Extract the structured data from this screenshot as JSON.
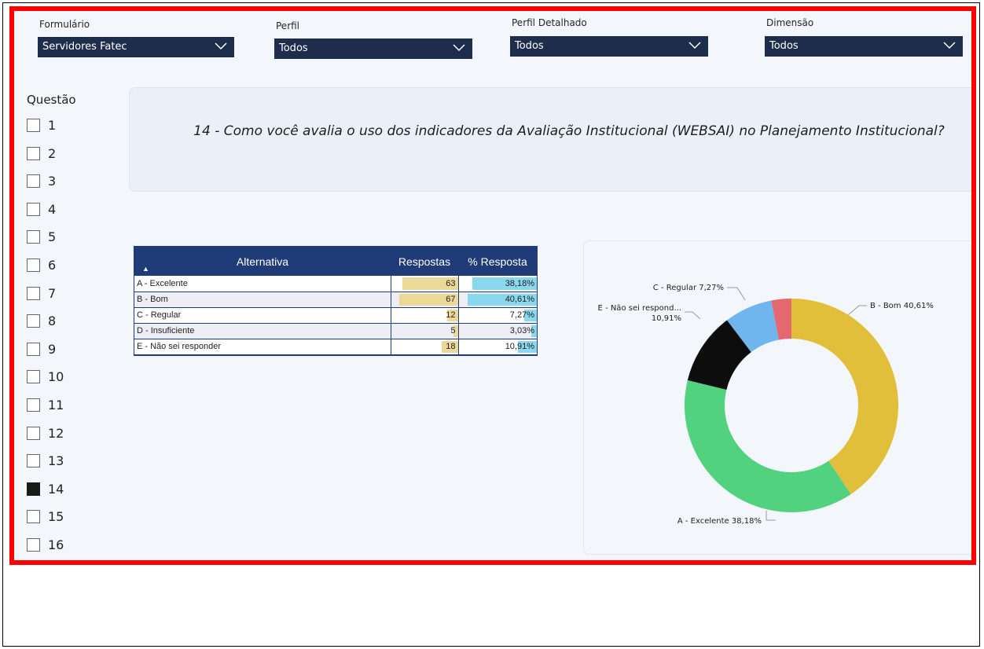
{
  "filters": [
    {
      "label": "Formulário",
      "value": "Servidores Fatec"
    },
    {
      "label": "Perfil",
      "value": "Todos"
    },
    {
      "label": "Perfil Detalhado",
      "value": "Todos"
    },
    {
      "label": "Dimensão",
      "value": "Todos"
    }
  ],
  "questions": {
    "label": "Questão",
    "items": [
      {
        "number": "1",
        "checked": false
      },
      {
        "number": "2",
        "checked": false
      },
      {
        "number": "3",
        "checked": false
      },
      {
        "number": "4",
        "checked": false
      },
      {
        "number": "5",
        "checked": false
      },
      {
        "number": "6",
        "checked": false
      },
      {
        "number": "7",
        "checked": false
      },
      {
        "number": "8",
        "checked": false
      },
      {
        "number": "9",
        "checked": false
      },
      {
        "number": "10",
        "checked": false
      },
      {
        "number": "11",
        "checked": false
      },
      {
        "number": "12",
        "checked": false
      },
      {
        "number": "13",
        "checked": false
      },
      {
        "number": "14",
        "checked": true
      },
      {
        "number": "15",
        "checked": false
      },
      {
        "number": "16",
        "checked": false
      }
    ]
  },
  "question_title": "14 - Como você avalia o uso dos indicadores da Avaliação Institucional (WEBSAI) no Planejamento Institucional?",
  "table": {
    "headers": [
      "Alternativa",
      "Respostas",
      "% Resposta"
    ],
    "rows": [
      {
        "alternativa": "A - Excelente",
        "respostas": "63",
        "percent": "38,18%"
      },
      {
        "alternativa": "B - Bom",
        "respostas": "67",
        "percent": "40,61%"
      },
      {
        "alternativa": "C - Regular",
        "respostas": "12",
        "percent": "7,27%"
      },
      {
        "alternativa": "D - Insuficiente",
        "respostas": "5",
        "percent": "3,03%"
      },
      {
        "alternativa": "E - Não sei responder",
        "respostas": "18",
        "percent": "10,91%"
      }
    ],
    "respostas_bar_color": "#ebd997",
    "percent_bar_color": "#8ad8ee"
  },
  "chart_data": {
    "type": "pie",
    "donut": true,
    "slices": [
      {
        "value": 40.61,
        "color": "#e2bf3a",
        "label": "B - Bom 40,61%"
      },
      {
        "value": 38.18,
        "color": "#52d27f",
        "label": "A - Excelente 38,18%"
      },
      {
        "value": 10.91,
        "color": "#0d0d0d",
        "label_lines": [
          "E - Não sei respond...",
          "10,91%"
        ]
      },
      {
        "value": 7.27,
        "color": "#6fb6ee",
        "label": "C - Regular 7,27%"
      },
      {
        "value": 3.03,
        "color": "#e46870",
        "label": ""
      }
    ]
  }
}
